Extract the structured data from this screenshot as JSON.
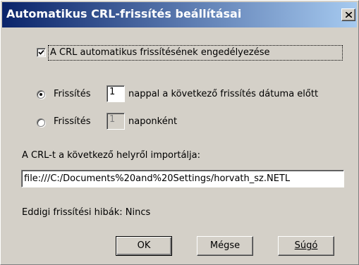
{
  "window": {
    "title": "Automatikus CRL-frissítés beállításai",
    "close_glyph": "×"
  },
  "auto_update": {
    "label": "A CRL automatikus frissítésének engedélyezése",
    "checked": true
  },
  "update_before": {
    "label_prefix": "Frissítés",
    "days_value": "1",
    "label_suffix": "nappal a következő frissítés dátuma előtt",
    "selected": true
  },
  "update_every": {
    "label_prefix": "Frissítés",
    "days_value": "1",
    "label_suffix": "naponként",
    "selected": false
  },
  "import_location": {
    "label": "A CRL-t a következő helyről importálja:",
    "url": "file:///C:/Documents%20and%20Settings/horvath_sz.NETL"
  },
  "status": {
    "text": "Eddigi frissítési hibák: Nincs"
  },
  "buttons": {
    "ok": "OK",
    "cancel": "Mégse",
    "help": "Súgó"
  },
  "colors": {
    "title_gradient_start": "#0a246a",
    "title_gradient_end": "#a6caf0",
    "face": "#d4d0c8"
  }
}
